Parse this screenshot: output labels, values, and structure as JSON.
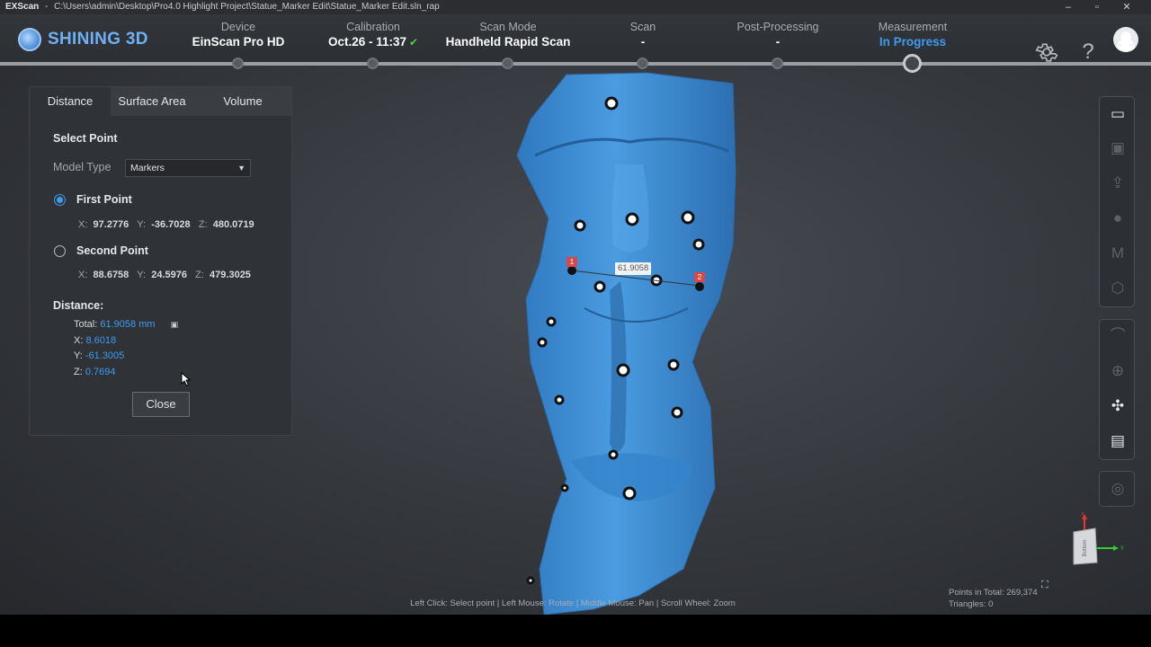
{
  "titlebar": {
    "app": "EXScan",
    "separator": "-",
    "path": "C:\\Users\\admin\\Desktop\\Pro4.0 Highlight Project\\Statue_Marker Edit\\Statue_Marker Edit.sln_rap",
    "minimize": "‒",
    "restore": "▫",
    "close": "✕"
  },
  "header": {
    "logo_text": "SHINING 3D",
    "steps": [
      {
        "label": "Device",
        "value": "EinScan Pro HD"
      },
      {
        "label": "Calibration",
        "value": "Oct.26 - 11:37"
      },
      {
        "label": "Scan Mode",
        "value": "Handheld Rapid Scan"
      },
      {
        "label": "Scan",
        "value": "-"
      },
      {
        "label": "Post-Processing",
        "value": "-"
      },
      {
        "label": "Measurement",
        "value": "In Progress"
      }
    ],
    "calibration_check": "✔",
    "settings_icon": "gear-icon",
    "help_icon": "help-icon",
    "current_step": "Measurement",
    "accent_color": "#3f9bf0"
  },
  "panel": {
    "tabs": [
      "Distance",
      "Surface Area",
      "Volume"
    ],
    "selected_tab": "Distance",
    "select_point_title": "Select Point",
    "model_type_label": "Model Type",
    "model_type_value": "Markers",
    "first_point": {
      "label": "First Point",
      "x_label": "X:",
      "x": "97.2776",
      "y_label": "Y:",
      "y": "-36.7028",
      "z_label": "Z:",
      "z": "480.0719"
    },
    "second_point": {
      "label": "Second Point",
      "x_label": "X:",
      "x": "88.6758",
      "y_label": "Y:",
      "y": "24.5976",
      "z_label": "Z:",
      "z": "479.3025"
    },
    "distance": {
      "title": "Distance:",
      "total_label": "Total:",
      "total_value": "61.9058",
      "unit": "mm",
      "x_label": "X:",
      "x_value": "8.6018",
      "y_label": "Y:",
      "y_value": "-61.3005",
      "z_label": "Z:",
      "z_value": "0.7694"
    },
    "close_label": "Close"
  },
  "viewport": {
    "distance_label": "61.9058",
    "point1_num": "1",
    "point2_num": "2",
    "hint": "Left Click: Select point | Left Mouse: Rotate | Middle Mouse: Pan | Scroll Wheel: Zoom",
    "points_label": "Points in Total:",
    "points_value": "269,374",
    "triangles_label": "Triangles:",
    "triangles_value": "0",
    "gizmo_face": "Bottom",
    "axis_x": "X",
    "axis_y": "Y",
    "model_color": "#3d8fd8"
  },
  "toolbar": {
    "group1": [
      "folder-icon",
      "save-icon",
      "export-icon",
      "texture-icon",
      "mesh-icon",
      "cube-icon"
    ],
    "group2": [
      "measure-icon",
      "target-icon",
      "markers-icon",
      "box-measure-icon"
    ],
    "group3": [
      "hide-icon"
    ]
  }
}
